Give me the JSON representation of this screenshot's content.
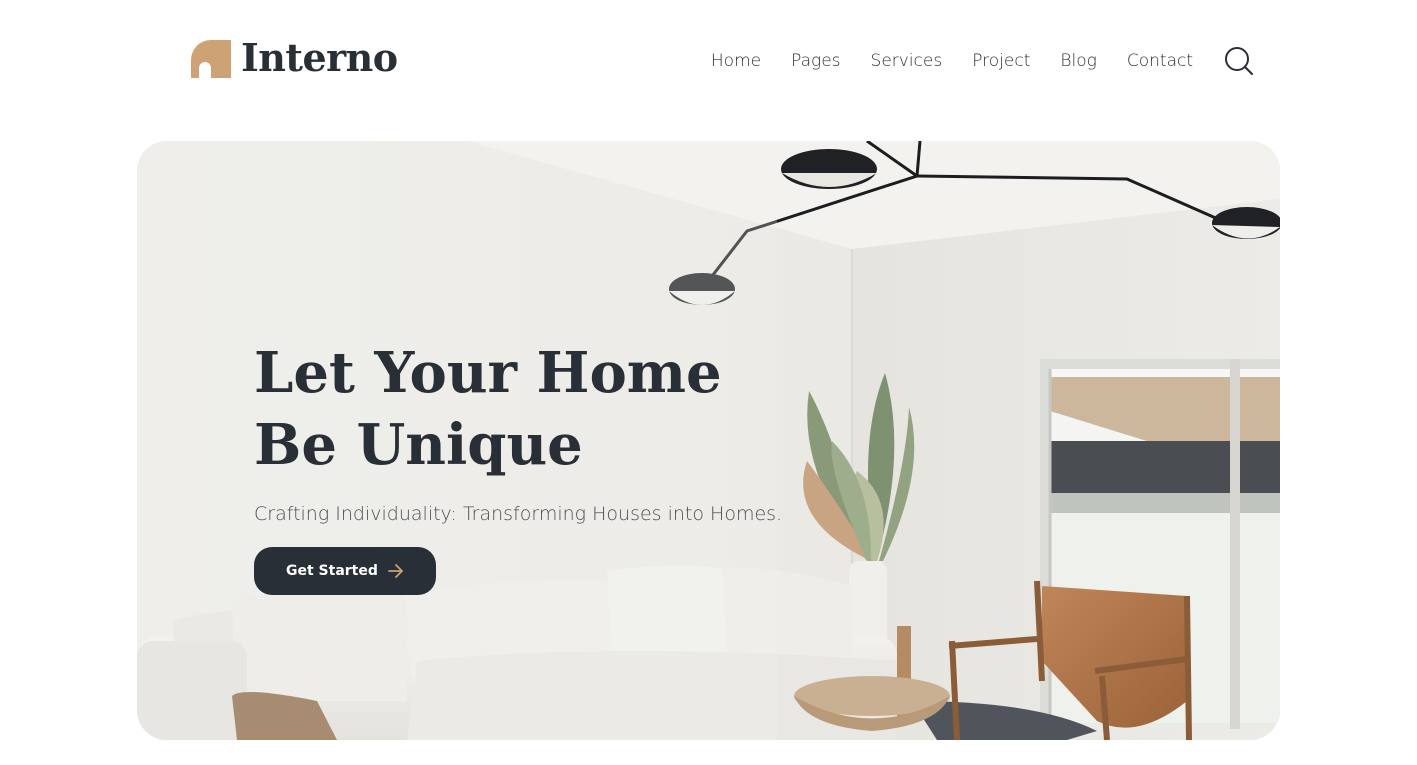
{
  "brand": {
    "name": "Interno",
    "accent": "#CDA274",
    "dark": "#292F36"
  },
  "nav": {
    "items": [
      {
        "label": "Home"
      },
      {
        "label": "Pages"
      },
      {
        "label": "Services"
      },
      {
        "label": "Project"
      },
      {
        "label": "Blog"
      },
      {
        "label": "Contact"
      }
    ],
    "search_icon": "search-icon"
  },
  "hero": {
    "title_line1": "Let Your Home",
    "title_line2": "Be Unique",
    "subtitle": "Crafting Individuality: Transforming Houses into Homes.",
    "cta_label": "Get Started",
    "cta_icon": "arrow-right-icon"
  }
}
